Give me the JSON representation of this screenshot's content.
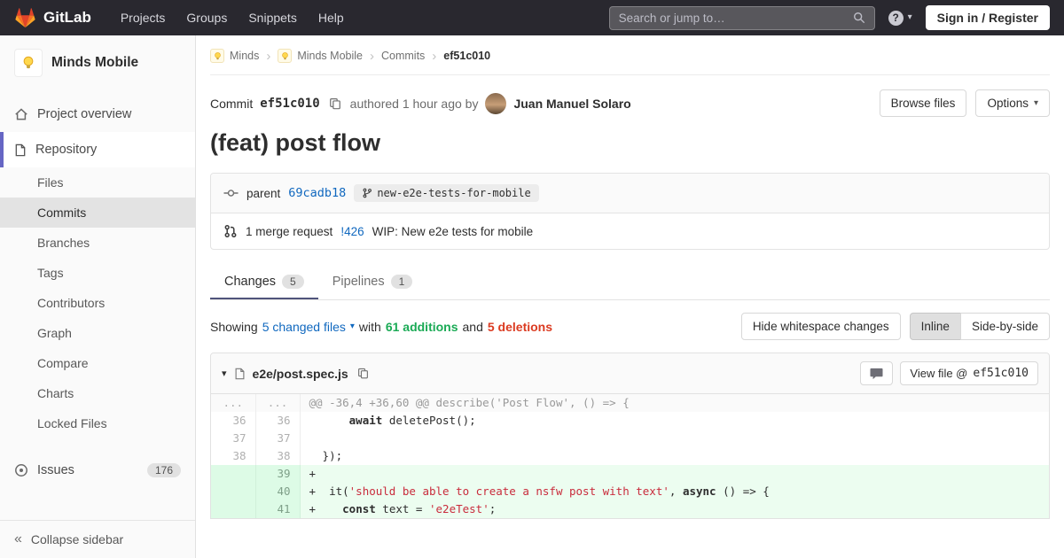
{
  "colors": {
    "navbar_bg": "#29282f",
    "link_blue": "#1068bf",
    "additions_green": "#1aaa55",
    "deletions_red": "#db3b21",
    "sidebar_active_indicator": "#6666c4",
    "added_line_bg": "#ecfdf0",
    "added_line_number_bg": "#ddfbe6"
  },
  "icons": {
    "caret_down": "▾",
    "breadcrumb_separator": "›",
    "collapse": "«",
    "question": "?"
  },
  "navbar": {
    "brand": "GitLab",
    "items": [
      "Projects",
      "Groups",
      "Snippets",
      "Help"
    ],
    "search_placeholder": "Search or jump to…",
    "sign_in_label": "Sign in / Register"
  },
  "sidebar": {
    "project_name": "Minds Mobile",
    "overview_label": "Project overview",
    "repository_label": "Repository",
    "repo_items": [
      "Files",
      "Commits",
      "Branches",
      "Tags",
      "Contributors",
      "Graph",
      "Compare",
      "Charts",
      "Locked Files"
    ],
    "active_repo_item": "Commits",
    "issues_label": "Issues",
    "issues_count": "176",
    "collapse_label": "Collapse sidebar"
  },
  "breadcrumb": {
    "items": [
      "Minds",
      "Minds Mobile",
      "Commits",
      "ef51c010"
    ]
  },
  "commit": {
    "label": "Commit",
    "sha": "ef51c010",
    "authored_text": "authored 1 hour ago by",
    "author": "Juan Manuel Solaro",
    "browse_files_label": "Browse files",
    "options_label": "Options",
    "title": "(feat) post flow",
    "parent_label": "parent",
    "parent_sha": "69cadb18",
    "branch_name": "new-e2e-tests-for-mobile",
    "mr_count_text": "1 merge request",
    "mr_ref": "!426",
    "mr_title": "WIP: New e2e tests for mobile"
  },
  "tabs": [
    {
      "label": "Changes",
      "count": "5"
    },
    {
      "label": "Pipelines",
      "count": "1"
    }
  ],
  "summary": {
    "showing_label": "Showing",
    "changed_files": "5 changed files",
    "with_label": "with",
    "additions_text": "61 additions",
    "and_label": "and",
    "deletions_text": "5 deletions",
    "hide_whitespace_label": "Hide whitespace changes",
    "inline_label": "Inline",
    "side_by_side_label": "Side-by-side"
  },
  "diff_file": {
    "name": "e2e/post.spec.js",
    "view_file_label": "View file @",
    "view_file_sha": "ef51c010",
    "rows": [
      {
        "type": "match",
        "old": "...",
        "new": "...",
        "segments": [
          [
            "h",
            "@@ -36,4 +36,60 @@ describe('Post Flow', () => {"
          ]
        ]
      },
      {
        "type": "context",
        "old": "36",
        "new": "36",
        "segments": [
          [
            "p",
            "      "
          ],
          [
            "k",
            "await"
          ],
          [
            "p",
            " deletePost();"
          ]
        ]
      },
      {
        "type": "context",
        "old": "37",
        "new": "37",
        "segments": [
          [
            "p",
            ""
          ]
        ]
      },
      {
        "type": "context",
        "old": "38",
        "new": "38",
        "segments": [
          [
            "p",
            "  });"
          ]
        ]
      },
      {
        "type": "added",
        "old": "",
        "new": "39",
        "segments": [
          [
            "p",
            "+"
          ]
        ]
      },
      {
        "type": "added",
        "old": "",
        "new": "40",
        "segments": [
          [
            "p",
            "+  it("
          ],
          [
            "s",
            "'should be able to create a nsfw post with text'"
          ],
          [
            "p",
            ", "
          ],
          [
            "k",
            "async"
          ],
          [
            "p",
            " () => {"
          ]
        ]
      },
      {
        "type": "added",
        "old": "",
        "new": "41",
        "segments": [
          [
            "p",
            "+    "
          ],
          [
            "k",
            "const"
          ],
          [
            "p",
            " text = "
          ],
          [
            "s",
            "'e2eTest'"
          ],
          [
            "p",
            ";"
          ]
        ]
      }
    ]
  }
}
